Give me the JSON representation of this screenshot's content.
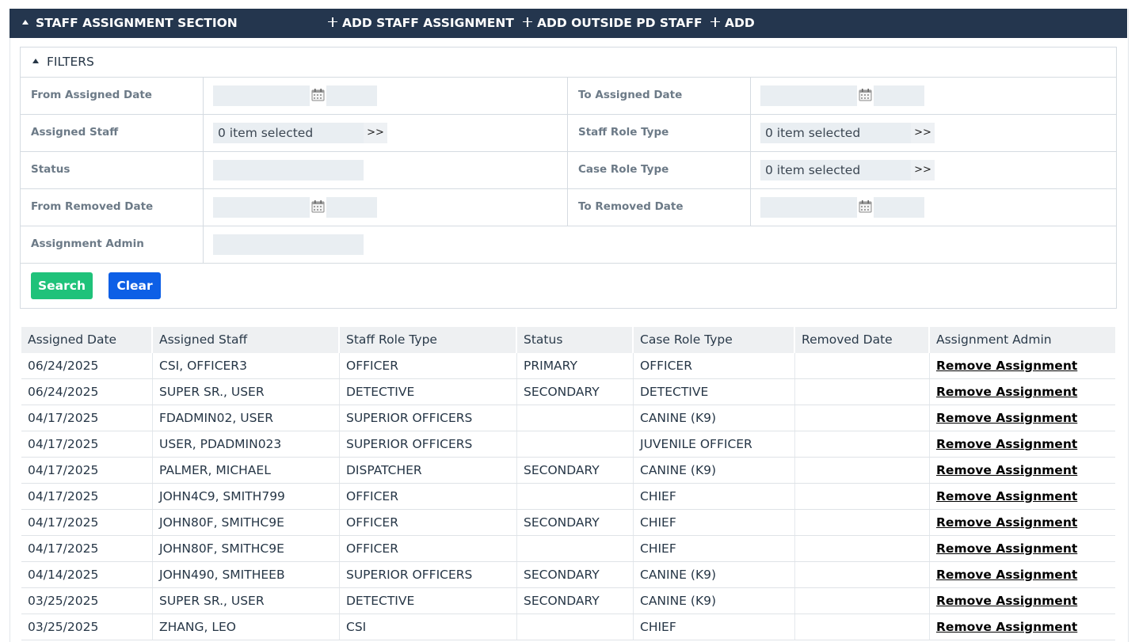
{
  "section": {
    "title": "STAFF ASSIGNMENT SECTION",
    "actions": [
      "ADD STAFF ASSIGNMENT",
      "ADD OUTSIDE PD STAFF",
      "ADD"
    ]
  },
  "filters": {
    "title": "FILTERS",
    "from_assigned_date": {
      "label": "From Assigned Date",
      "value": ""
    },
    "to_assigned_date": {
      "label": "To Assigned Date",
      "value": ""
    },
    "assigned_staff": {
      "label": "Assigned Staff",
      "value": "0 item selected",
      "more": ">>"
    },
    "staff_role_type": {
      "label": "Staff Role Type",
      "value": "0 item selected",
      "more": ">>"
    },
    "status": {
      "label": "Status",
      "value": ""
    },
    "case_role_type": {
      "label": "Case Role Type",
      "value": "0 item selected",
      "more": ">>"
    },
    "from_removed_date": {
      "label": "From Removed Date",
      "value": ""
    },
    "to_removed_date": {
      "label": "To Removed Date",
      "value": ""
    },
    "assignment_admin": {
      "label": "Assignment Admin",
      "value": ""
    },
    "search_label": "Search",
    "clear_label": "Clear"
  },
  "table": {
    "columns": [
      "Assigned Date",
      "Assigned Staff",
      "Staff Role Type",
      "Status",
      "Case Role Type",
      "Removed Date",
      "Assignment Admin"
    ],
    "rows": [
      [
        "06/24/2025",
        "CSI, OFFICER3",
        "OFFICER",
        "PRIMARY",
        "OFFICER",
        "",
        "Remove Assignment"
      ],
      [
        "06/24/2025",
        "SUPER SR., USER",
        "DETECTIVE",
        "SECONDARY",
        "DETECTIVE",
        "",
        "Remove Assignment"
      ],
      [
        "04/17/2025",
        "FDADMIN02, USER",
        "SUPERIOR OFFICERS",
        "",
        "CANINE (K9)",
        "",
        "Remove Assignment"
      ],
      [
        "04/17/2025",
        "USER, PDADMIN023",
        "SUPERIOR OFFICERS",
        "",
        "JUVENILE OFFICER",
        "",
        "Remove Assignment"
      ],
      [
        "04/17/2025",
        "PALMER, MICHAEL",
        "DISPATCHER",
        "SECONDARY",
        "CANINE (K9)",
        "",
        "Remove Assignment"
      ],
      [
        "04/17/2025",
        "JOHN4C9, SMITH799",
        "OFFICER",
        "",
        "CHIEF",
        "",
        "Remove Assignment"
      ],
      [
        "04/17/2025",
        "JOHN80F, SMITHC9E",
        "OFFICER",
        "SECONDARY",
        "CHIEF",
        "",
        "Remove Assignment"
      ],
      [
        "04/17/2025",
        "JOHN80F, SMITHC9E",
        "OFFICER",
        "",
        "CHIEF",
        "",
        "Remove Assignment"
      ],
      [
        "04/14/2025",
        "JOHN490, SMITHEEB",
        "SUPERIOR OFFICERS",
        "SECONDARY",
        "CANINE (K9)",
        "",
        "Remove Assignment"
      ],
      [
        "03/25/2025",
        "SUPER SR., USER",
        "DETECTIVE",
        "SECONDARY",
        "CANINE (K9)",
        "",
        "Remove Assignment"
      ],
      [
        "03/25/2025",
        "ZHANG, LEO",
        "CSI",
        "",
        "CHIEF",
        "",
        "Remove Assignment"
      ]
    ]
  },
  "colors": {
    "header_bg": "#24364e",
    "search_btn": "#1fc27a",
    "clear_btn": "#0d5fe6",
    "input_bg": "#e9eef2"
  }
}
